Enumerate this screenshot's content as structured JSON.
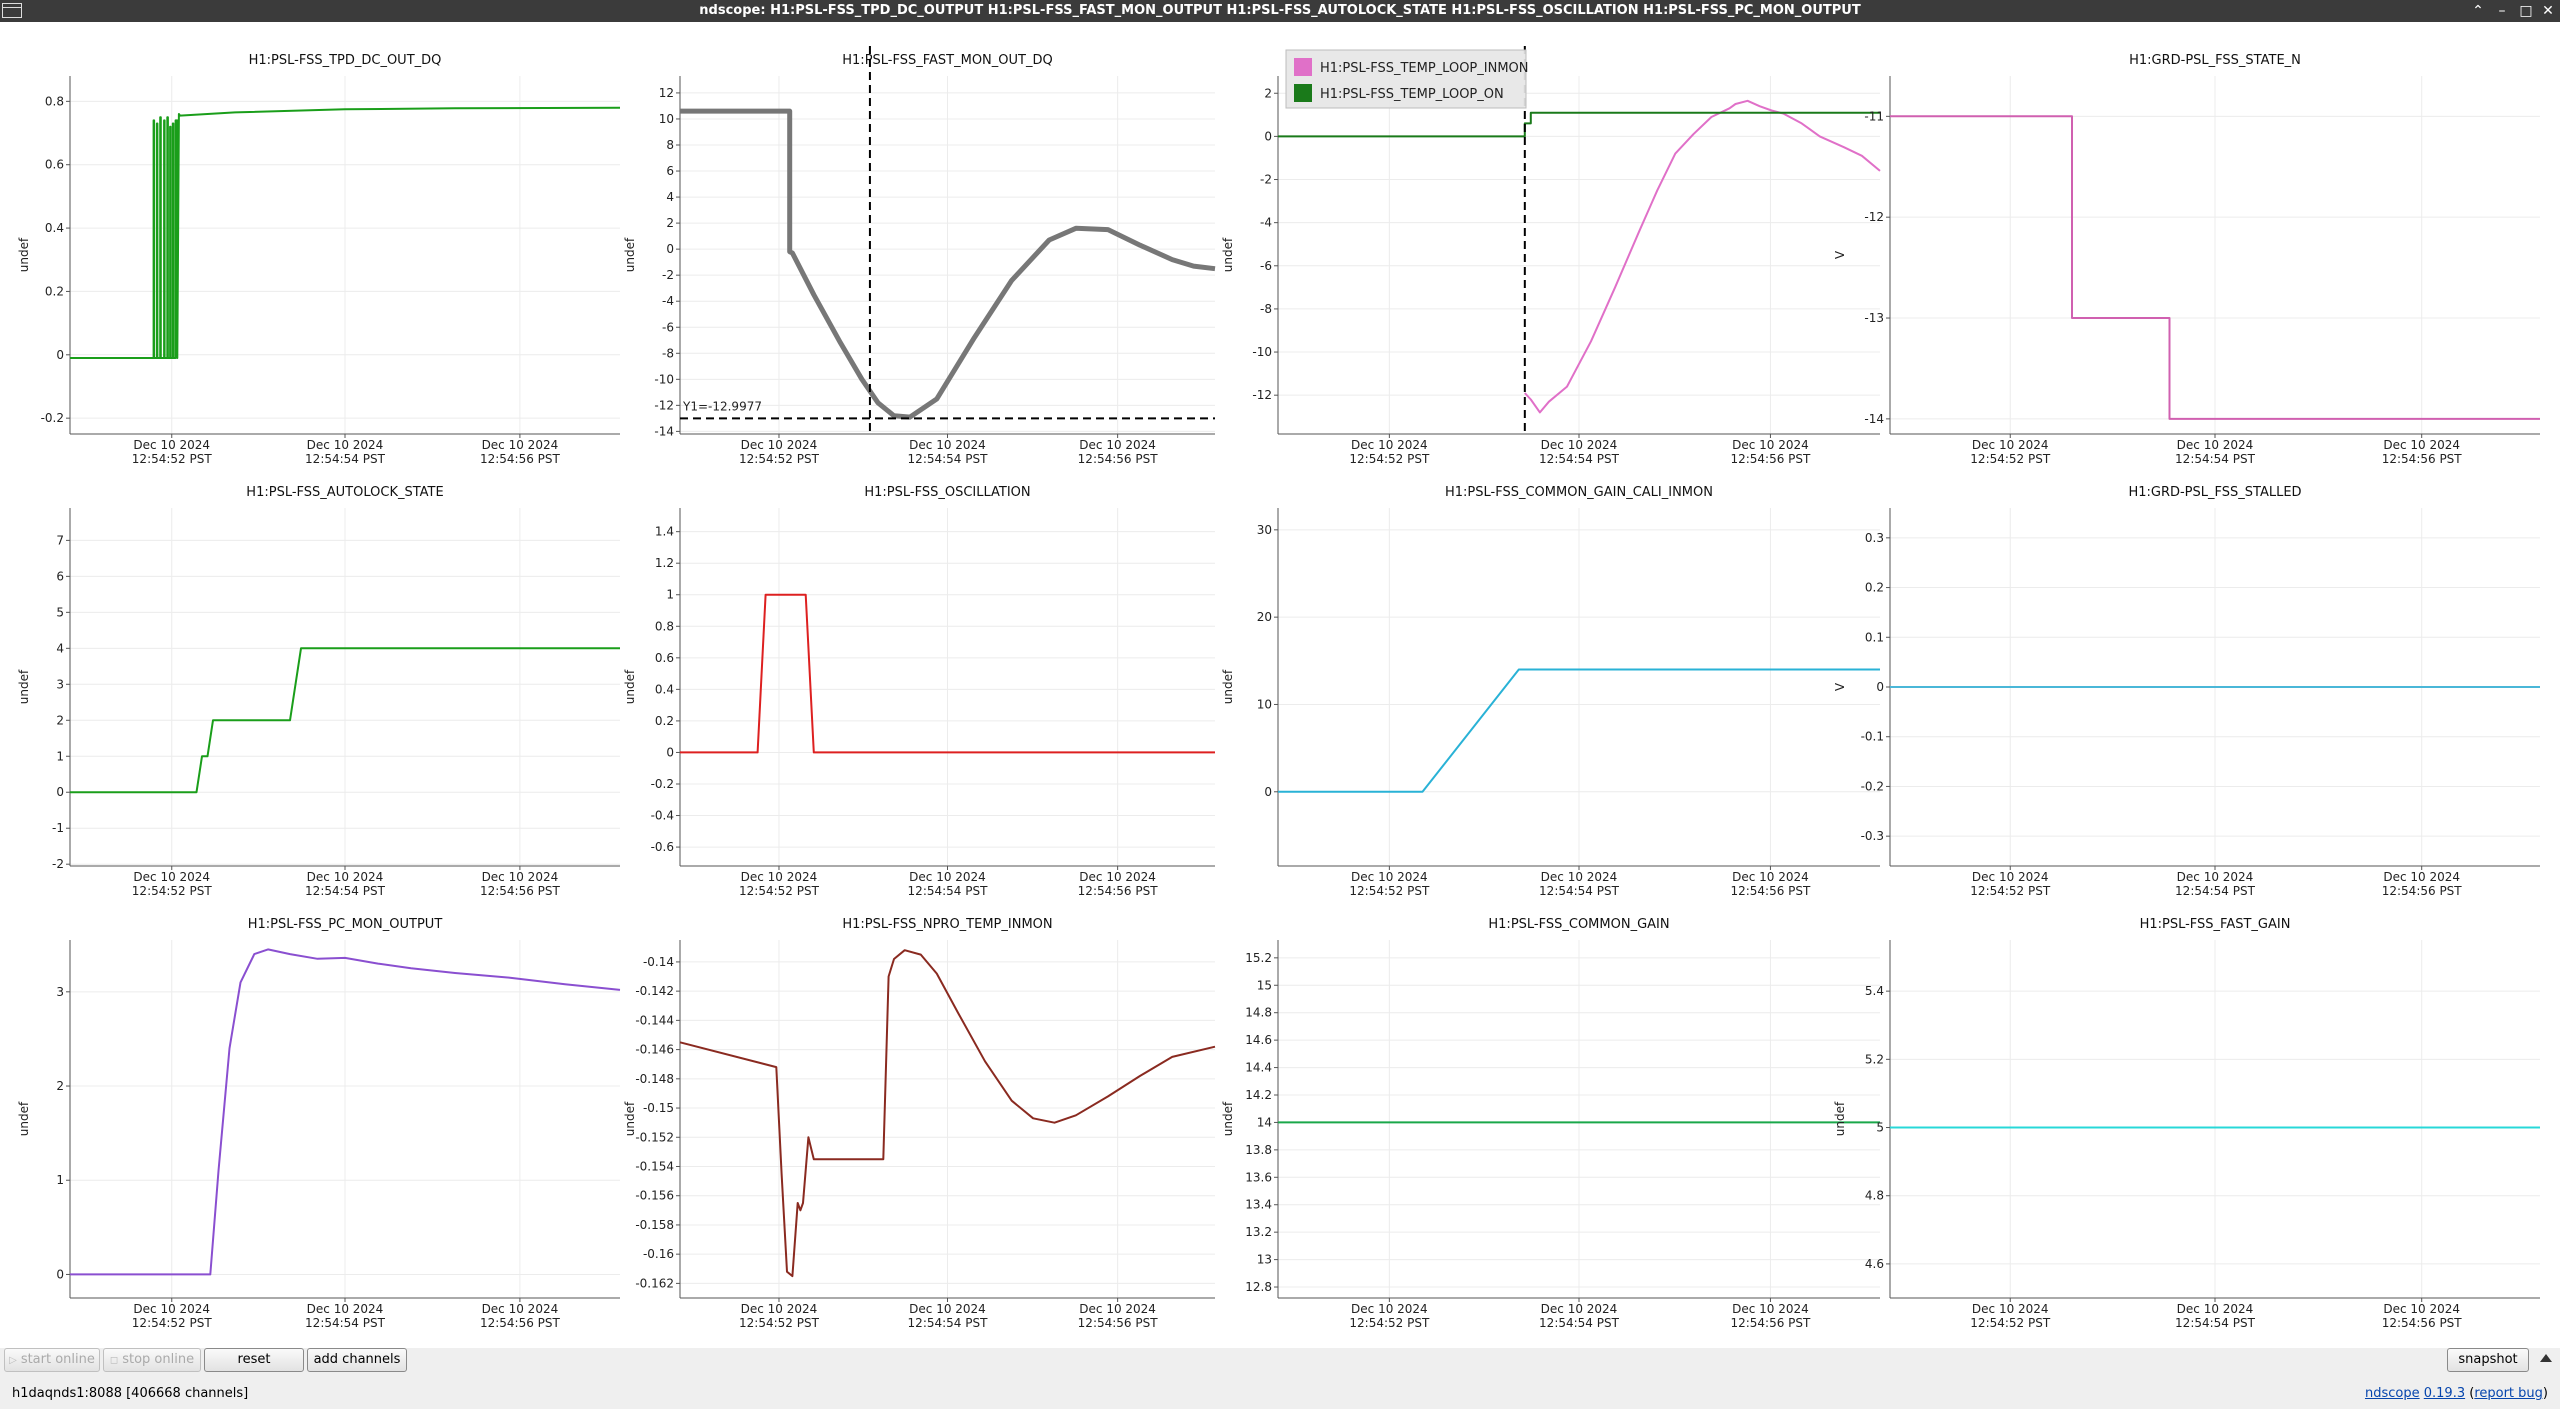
{
  "window": {
    "title": "ndscope: H1:PSL-FSS_TPD_DC_OUTPUT H1:PSL-FSS_FAST_MON_OUTPUT H1:PSL-FSS_AUTOLOCK_STATE H1:PSL-FSS_OSCILLATION H1:PSL-FSS_PC_MON_OUTPUT",
    "controls": [
      "⌃",
      "–",
      "□",
      "✕"
    ]
  },
  "time_ticks": [
    {
      "line1": "Dec 10 2024",
      "line2": "12:54:52 PST"
    },
    {
      "line1": "Dec 10 2024",
      "line2": "12:54:54 PST"
    },
    {
      "line1": "Dec 10 2024",
      "line2": "12:54:56 PST"
    }
  ],
  "plots": [
    {
      "title": "H1:PSL-FSS_TPD_DC_OUT_DQ",
      "ylabel": "undef",
      "color": "#1a9e1a",
      "yticks": [
        "0.8",
        "0.6",
        "0.4",
        "0.2",
        "0",
        "-0.2"
      ],
      "ylim": [
        -0.25,
        0.88
      ],
      "x": [
        0,
        0.152,
        0.152,
        0.153,
        0.153,
        0.158,
        0.158,
        0.159,
        0.159,
        0.164,
        0.164,
        0.165,
        0.165,
        0.171,
        0.171,
        0.172,
        0.172,
        0.177,
        0.177,
        0.178,
        0.178,
        0.182,
        0.182,
        0.183,
        0.183,
        0.187,
        0.187,
        0.188,
        0.188,
        0.192,
        0.192,
        0.195,
        0.195,
        0.198,
        0.2,
        0.3,
        0.5,
        0.7,
        1.0
      ],
      "y": [
        -0.01,
        -0.01,
        0.74,
        0.74,
        -0.01,
        -0.01,
        0.73,
        0.73,
        -0.01,
        -0.01,
        0.75,
        0.75,
        -0.01,
        -0.01,
        0.74,
        0.74,
        -0.01,
        -0.01,
        0.75,
        0.75,
        -0.01,
        -0.01,
        0.72,
        0.72,
        -0.01,
        -0.01,
        0.73,
        0.73,
        -0.01,
        -0.01,
        0.74,
        0.74,
        -0.01,
        0.76,
        0.755,
        0.765,
        0.775,
        0.778,
        0.78
      ]
    },
    {
      "title": "H1:PSL-FSS_FAST_MON_OUT_DQ",
      "ylabel": "undef",
      "color": "#777777",
      "yticks": [
        "12",
        "10",
        "8",
        "6",
        "4",
        "2",
        "0",
        "-2",
        "-4",
        "-6",
        "-8",
        "-10",
        "-12",
        "-14"
      ],
      "ylim": [
        -14.2,
        13.3
      ],
      "x": [
        0,
        0.205,
        0.205,
        0.21,
        0.25,
        0.3,
        0.34,
        0.37,
        0.4,
        0.43,
        0.48,
        0.55,
        0.62,
        0.69,
        0.74,
        0.8,
        0.86,
        0.92,
        0.96,
        1.0
      ],
      "y": [
        10.6,
        10.6,
        -0.2,
        -0.3,
        -3.5,
        -7.2,
        -10,
        -11.8,
        -12.8,
        -12.9,
        -11.5,
        -6.8,
        -2.4,
        0.7,
        1.6,
        1.5,
        0.3,
        -0.8,
        -1.3,
        -1.5
      ],
      "cursor_x": 0.355,
      "cursor_y": -12.9977,
      "cursor_label": "Y1=-12.9977",
      "thick": true
    },
    {
      "title": "",
      "ylabel": "undef",
      "yticks": [
        "2",
        "0",
        "-2",
        "-4",
        "-6",
        "-8",
        "-10",
        "-12"
      ],
      "ylim": [
        -13.8,
        2.8
      ],
      "legend": [
        {
          "name": "H1:PSL-FSS_TEMP_LOOP_INMON",
          "color": "#e070c8"
        },
        {
          "name": "H1:PSL-FSS_TEMP_LOOP_ON",
          "color": "#1a7a1a"
        }
      ],
      "series": [
        {
          "color": "#e070c8",
          "x": [
            0.41,
            0.42,
            0.435,
            0.45,
            0.48,
            0.52,
            0.56,
            0.6,
            0.63,
            0.66,
            0.69,
            0.72,
            0.75,
            0.76,
            0.78,
            0.8,
            0.82,
            0.84,
            0.87,
            0.9,
            0.94,
            0.97,
            1.0
          ],
          "y": [
            -11.9,
            -12.2,
            -12.8,
            -12.3,
            -11.6,
            -9.5,
            -7,
            -4.4,
            -2.5,
            -0.8,
            0.1,
            0.9,
            1.3,
            1.5,
            1.65,
            1.4,
            1.2,
            1.05,
            0.6,
            0,
            -0.5,
            -0.9,
            -1.6
          ]
        },
        {
          "color": "#1a7a1a",
          "x": [
            0,
            0.41,
            0.41,
            0.42,
            0.42,
            1.0
          ],
          "y": [
            0,
            0,
            0.6,
            0.6,
            1.1,
            1.1
          ]
        }
      ],
      "cursor_x": 0.41
    },
    {
      "title": "H1:GRD-PSL_FSS_STATE_N",
      "ylabel": "V",
      "color": "#d060b0",
      "yticks": [
        "-11",
        "-12",
        "-13",
        "-14"
      ],
      "ylim": [
        -14.15,
        -10.6
      ],
      "x": [
        0,
        0.28,
        0.28,
        0.43,
        0.43,
        1.0
      ],
      "y": [
        -11,
        -11,
        -13,
        -13,
        -14,
        -14
      ]
    },
    {
      "title": "H1:PSL-FSS_AUTOLOCK_STATE",
      "ylabel": "undef",
      "color": "#1a9e1a",
      "yticks": [
        "7",
        "6",
        "5",
        "4",
        "3",
        "2",
        "1",
        "0",
        "-1",
        "-2"
      ],
      "ylim": [
        -2.05,
        7.9
      ],
      "x": [
        0,
        0.23,
        0.24,
        0.25,
        0.26,
        0.27,
        0.4,
        0.42,
        1.0
      ],
      "y": [
        0,
        0,
        1,
        1,
        2,
        2,
        2,
        4,
        4
      ]
    },
    {
      "title": "H1:PSL-FSS_OSCILLATION",
      "ylabel": "undef",
      "color": "#dd2020",
      "yticks": [
        "1.4",
        "1.2",
        "1",
        "0.8",
        "0.6",
        "0.4",
        "0.2",
        "0",
        "-0.2",
        "-0.4",
        "-0.6"
      ],
      "ylim": [
        -0.72,
        1.55
      ],
      "x": [
        0,
        0.145,
        0.16,
        0.235,
        0.25,
        1.0
      ],
      "y": [
        0,
        0,
        1,
        1,
        0,
        0
      ]
    },
    {
      "title": "H1:PSL-FSS_COMMON_GAIN_CALI_INMON",
      "ylabel": "undef",
      "color": "#29b2d6",
      "yticks": [
        "30",
        "20",
        "10",
        "0"
      ],
      "ylim": [
        -8.5,
        32.5
      ],
      "x": [
        0,
        0.24,
        0.4,
        1.0
      ],
      "y": [
        0,
        0,
        14,
        14
      ]
    },
    {
      "title": "H1:GRD-PSL_FSS_STALLED",
      "ylabel": "V",
      "color": "#4ab7d8",
      "yticks": [
        "0.3",
        "0.2",
        "0.1",
        "0",
        "-0.1",
        "-0.2",
        "-0.3"
      ],
      "ylim": [
        -0.36,
        0.36
      ],
      "x": [
        0,
        1.0
      ],
      "y": [
        0,
        0
      ]
    },
    {
      "title": "H1:PSL-FSS_PC_MON_OUTPUT",
      "ylabel": "undef",
      "color": "#8a4fd0",
      "yticks": [
        "3",
        "2",
        "1",
        "0"
      ],
      "ylim": [
        -0.25,
        3.55
      ],
      "x": [
        0,
        0.255,
        0.27,
        0.29,
        0.31,
        0.335,
        0.36,
        0.4,
        0.45,
        0.5,
        0.56,
        0.62,
        0.7,
        0.8,
        0.9,
        1.0
      ],
      "y": [
        0,
        0,
        1.1,
        2.4,
        3.1,
        3.4,
        3.45,
        3.4,
        3.35,
        3.36,
        3.3,
        3.25,
        3.2,
        3.15,
        3.08,
        3.02
      ]
    },
    {
      "title": "H1:PSL-FSS_NPRO_TEMP_INMON",
      "ylabel": "undef",
      "color": "#8a2a20",
      "yticks": [
        "-0.14",
        "-0.142",
        "-0.144",
        "-0.146",
        "-0.148",
        "-0.15",
        "-0.152",
        "-0.154",
        "-0.156",
        "-0.158",
        "-0.16",
        "-0.162"
      ],
      "ylim": [
        -0.163,
        -0.1385
      ],
      "x": [
        0,
        0.18,
        0.19,
        0.2,
        0.21,
        0.22,
        0.225,
        0.23,
        0.24,
        0.25,
        0.255,
        0.38,
        0.39,
        0.4,
        0.42,
        0.45,
        0.48,
        0.52,
        0.57,
        0.62,
        0.66,
        0.7,
        0.74,
        0.8,
        0.86,
        0.92,
        1.0
      ],
      "y": [
        -0.1455,
        -0.1472,
        -0.1545,
        -0.1612,
        -0.1615,
        -0.1565,
        -0.157,
        -0.1565,
        -0.152,
        -0.1535,
        -0.1535,
        -0.1535,
        -0.141,
        -0.1398,
        -0.1392,
        -0.1395,
        -0.1408,
        -0.1435,
        -0.1468,
        -0.1495,
        -0.1507,
        -0.151,
        -0.1505,
        -0.1492,
        -0.1478,
        -0.1465,
        -0.1458
      ]
    },
    {
      "title": "H1:PSL-FSS_COMMON_GAIN",
      "ylabel": "undef",
      "color": "#1aa84a",
      "yticks": [
        "15.2",
        "15",
        "14.8",
        "14.6",
        "14.4",
        "14.2",
        "14",
        "13.8",
        "13.6",
        "13.4",
        "13.2",
        "13",
        "12.8"
      ],
      "ylim": [
        12.72,
        15.33
      ],
      "x": [
        0,
        1.0
      ],
      "y": [
        14,
        14
      ]
    },
    {
      "title": "H1:PSL-FSS_FAST_GAIN",
      "ylabel": "undef",
      "color": "#28d8d8",
      "yticks": [
        "5.4",
        "5.2",
        "5",
        "4.8",
        "4.6"
      ],
      "ylim": [
        4.5,
        5.55
      ],
      "x": [
        0,
        1.0
      ],
      "y": [
        5,
        5
      ]
    }
  ],
  "toolbar": {
    "start_online": "start online",
    "stop_online": "stop online",
    "reset": "reset",
    "add_channels": "add channels",
    "snapshot": "snapshot"
  },
  "status": {
    "server": "h1daqnds1:8088  [406668 channels]",
    "app_name": "ndscope",
    "version": "0.19.3",
    "report_bug": "report bug"
  }
}
